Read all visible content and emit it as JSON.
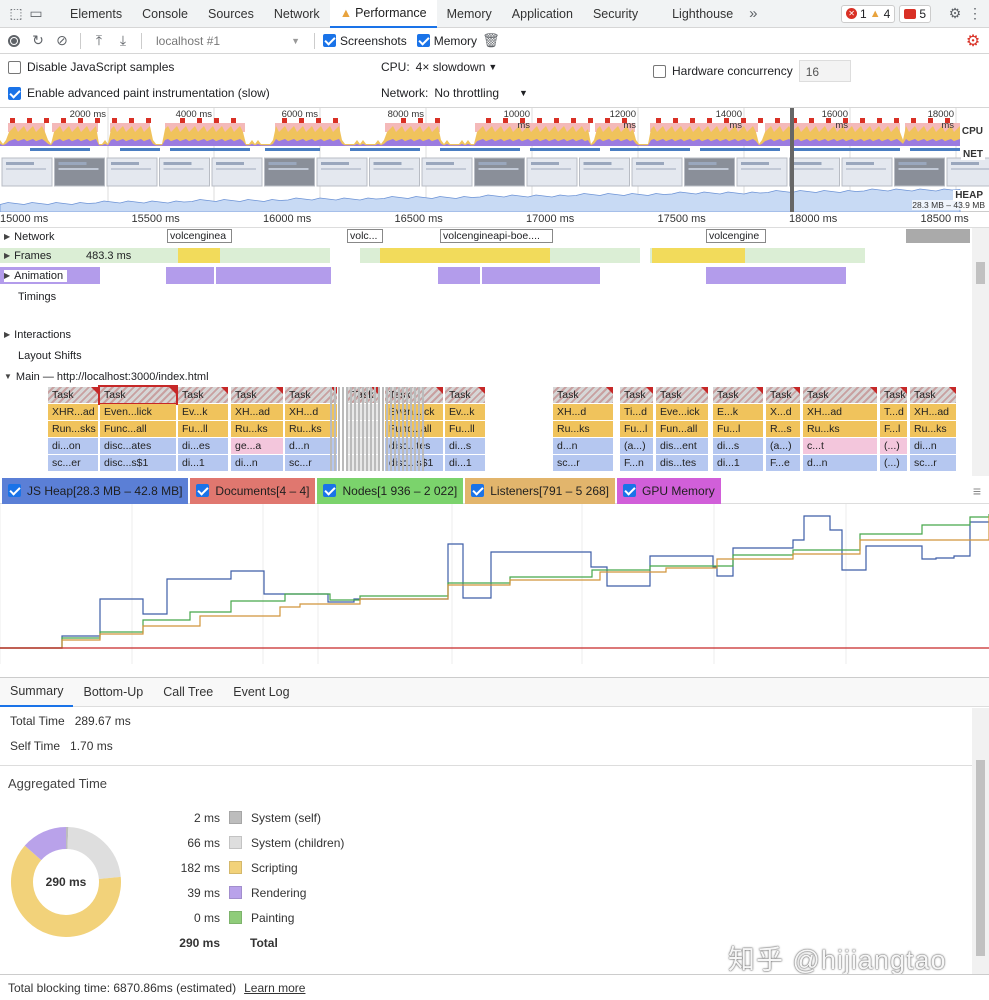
{
  "tabbar": {
    "tabs": [
      "Elements",
      "Console",
      "Sources",
      "Network",
      "Performance",
      "Memory",
      "Application",
      "Security",
      "Lighthouse"
    ],
    "active": "Performance",
    "more_icon": "chevron-double-right-icon",
    "errors": "1",
    "warnings": "4",
    "issues": "5"
  },
  "toolbar": {
    "profile_select": "localhost #1",
    "screenshots_label": "Screenshots",
    "memory_label": "Memory"
  },
  "settings": {
    "disable_js_samples": "Disable JavaScript samples",
    "advanced_paint": "Enable advanced paint instrumentation (slow)",
    "cpu_label": "CPU:",
    "cpu_value": "4× slowdown",
    "network_label": "Network:",
    "network_value": "No throttling",
    "hw_label": "Hardware concurrency",
    "hw_value": "16"
  },
  "overview": {
    "ticks": [
      "2000 ms",
      "4000 ms",
      "6000 ms",
      "8000 ms",
      "10000 ms",
      "12000 ms",
      "14000 ms",
      "16000 ms",
      "18000 ms"
    ],
    "cpu_label": "CPU",
    "net_label": "NET",
    "heap_label": "HEAP",
    "heap_range": "28.3 MB – 43.9 MB"
  },
  "ruler": {
    "ticks": [
      "15000 ms",
      "15500 ms",
      "16000 ms",
      "16500 ms",
      "17000 ms",
      "17500 ms",
      "18000 ms",
      "18500 ms"
    ]
  },
  "tracks": {
    "network": "Network",
    "network_reqs": [
      "volcenginea",
      "volc...",
      "volcengineapi-boe....",
      "volcengine"
    ],
    "frames": "Frames",
    "frames_ms": "483.3 ms",
    "animation": "Animation",
    "timings": "Timings",
    "interactions": "Interactions",
    "layout_shifts": "Layout Shifts",
    "main": "Main — http://localhost:3000/index.html"
  },
  "flame": {
    "columns": [
      [
        "Task",
        "XHR...ad",
        "Run...sks",
        "di...on",
        "sc...er"
      ],
      [
        "Task",
        "Even...lick",
        "Func...all",
        "disc...ates",
        "disc...s$1"
      ],
      [
        "Task",
        "Ev...k",
        "Fu...ll",
        "di...es",
        "di...1"
      ],
      [
        "Task",
        "XH...ad",
        "Ru...ks",
        "ge...a",
        "di...n"
      ],
      [
        "Task",
        "XH...d",
        "Ru...ks",
        "d...n",
        "sc...r"
      ],
      [
        "Task",
        "",
        "",
        "",
        ""
      ],
      [
        "Task",
        "Even...ick",
        "Func...all",
        "disc...tes",
        "disc...s$1"
      ],
      [
        "Task",
        "Ev...k",
        "Fu...ll",
        "di...s",
        "di...1"
      ],
      [
        "Task",
        "XH...d",
        "Ru...ks",
        "d...n",
        "sc...r"
      ],
      [
        "Task",
        "Ti...d",
        "Fu...l",
        "(a...)",
        "F...n"
      ],
      [
        "Task",
        "Eve...ick",
        "Fun...all",
        "dis...ent",
        "dis...tes"
      ],
      [
        "Task",
        "E...k",
        "Fu...l",
        "di...s",
        "di...1"
      ],
      [
        "Task",
        "X...d",
        "R...s",
        "(a...)",
        "F...e"
      ],
      [
        "Task",
        "XH...ad",
        "Ru...ks",
        "c...t",
        "d...n"
      ],
      [
        "Task",
        "T...d",
        "F...l",
        "(...)",
        "(...)"
      ],
      [
        "Task",
        "XH...ad",
        "Ru...ks",
        "di...n",
        "sc...r"
      ]
    ]
  },
  "counters": [
    {
      "label": "JS Heap[28.3 MB – 42.8 MB]",
      "color": "#5b7fd6"
    },
    {
      "label": "Documents[4 – 4]",
      "color": "#e0776f"
    },
    {
      "label": "Nodes[1 936 – 2 022]",
      "color": "#7bd36c"
    },
    {
      "label": "Listeners[791 – 5 268]",
      "color": "#e2b56c"
    },
    {
      "label": "GPU Memory",
      "color": "#d15fd9"
    }
  ],
  "bottom_tabs": [
    "Summary",
    "Bottom-Up",
    "Call Tree",
    "Event Log"
  ],
  "summary": {
    "total_time_label": "Total Time",
    "total_time": "289.67 ms",
    "self_time_label": "Self Time",
    "self_time": "1.70 ms",
    "aggregated_title": "Aggregated Time",
    "donut_center": "290 ms",
    "legend": [
      {
        "value": "2 ms",
        "label": "System (self)",
        "color": "#bdbdbd",
        "ms": 2
      },
      {
        "value": "66 ms",
        "label": "System (children)",
        "color": "#dedede",
        "ms": 66
      },
      {
        "value": "182 ms",
        "label": "Scripting",
        "color": "#f2d27a",
        "ms": 182
      },
      {
        "value": "39 ms",
        "label": "Rendering",
        "color": "#b9a2ea",
        "ms": 39
      },
      {
        "value": "0 ms",
        "label": "Painting",
        "color": "#8fcc7a",
        "ms": 0
      }
    ],
    "total_value": "290 ms",
    "total_label": "Total"
  },
  "footer": {
    "text": "Total blocking time: 6870.86ms (estimated)",
    "link": "Learn more"
  },
  "watermark": "知乎 @hijiangtao"
}
